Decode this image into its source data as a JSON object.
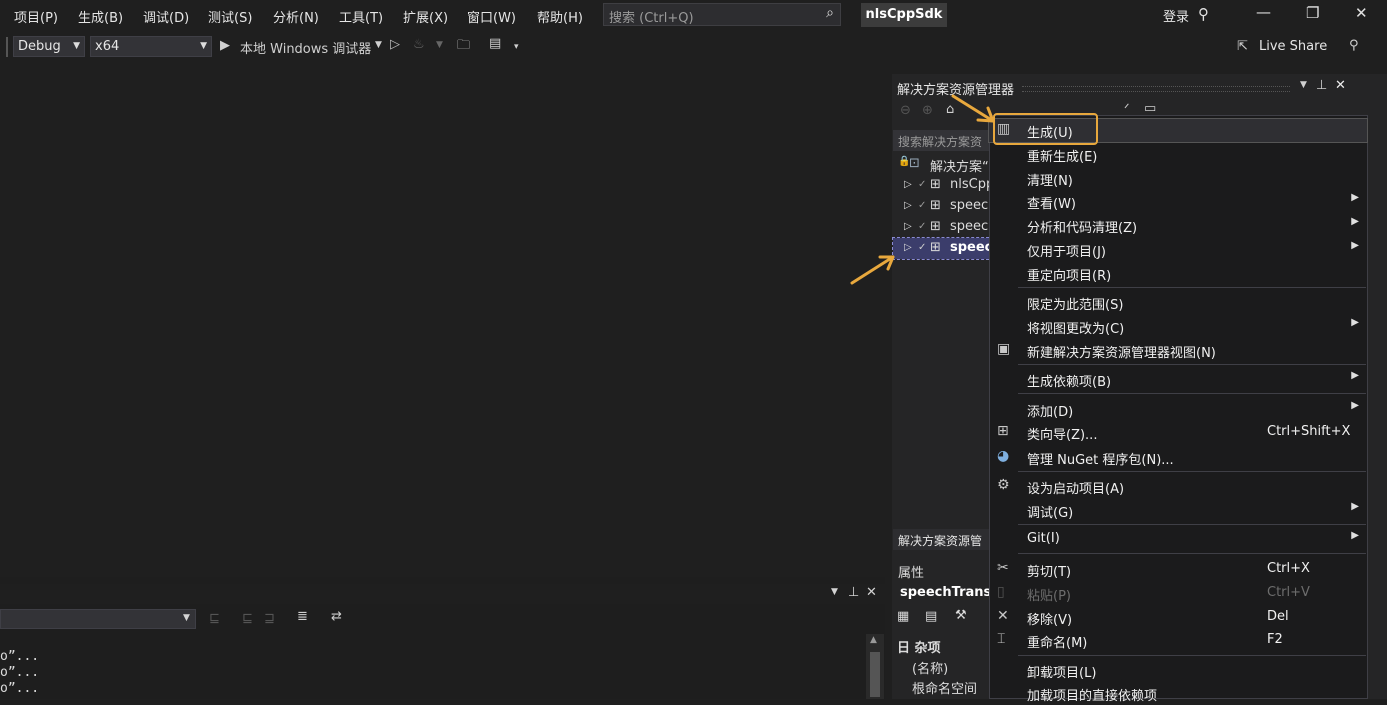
{
  "menubar": {
    "items": [
      "项目(P)",
      "生成(B)",
      "调试(D)",
      "测试(S)",
      "分析(N)",
      "工具(T)",
      "扩展(X)",
      "窗口(W)",
      "帮助(H)"
    ],
    "search_placeholder": "搜索 (Ctrl+Q)",
    "solution_name": "nlsCppSdk",
    "login": "登录"
  },
  "toolbar": {
    "config": "Debug",
    "platform": "x64",
    "run_label": "本地 Windows 调试器",
    "live_share": "Live Share"
  },
  "solution_explorer": {
    "title": "解决方案资源管理器",
    "search_placeholder": "搜索解决方案资",
    "tree": [
      "解决方案“",
      "nlsCpp",
      "speec",
      "speec",
      "speec"
    ],
    "bottom_tab": "解决方案资源管"
  },
  "context_menu": {
    "items": [
      {
        "label": "生成(U)",
        "icon": "build-icon"
      },
      {
        "label": "重新生成(E)"
      },
      {
        "label": "清理(N)"
      },
      {
        "label": "查看(W)",
        "submenu": true
      },
      {
        "label": "分析和代码清理(Z)",
        "submenu": true
      },
      {
        "label": "仅用于项目(J)",
        "submenu": true
      },
      {
        "label": "重定向项目(R)"
      },
      {
        "label": "限定为此范围(S)"
      },
      {
        "label": "将视图更改为(C)",
        "submenu": true
      },
      {
        "label": "新建解决方案资源管理器视图(N)",
        "icon": "new-view-icon"
      },
      {
        "label": "生成依赖项(B)",
        "submenu": true
      },
      {
        "label": "添加(D)",
        "submenu": true
      },
      {
        "label": "类向导(Z)...",
        "shortcut": "Ctrl+Shift+X",
        "icon": "class-wizard-icon"
      },
      {
        "label": "管理 NuGet 程序包(N)...",
        "icon": "nuget-icon"
      },
      {
        "label": "设为启动项目(A)",
        "icon": "gear-icon"
      },
      {
        "label": "调试(G)",
        "submenu": true
      },
      {
        "label": "Git(I)",
        "submenu": true
      },
      {
        "label": "剪切(T)",
        "shortcut": "Ctrl+X",
        "icon": "scissors-icon"
      },
      {
        "label": "粘贴(P)",
        "shortcut": "Ctrl+V",
        "icon": "paste-icon",
        "disabled": true
      },
      {
        "label": "移除(V)",
        "shortcut": "Del",
        "icon": "remove-icon"
      },
      {
        "label": "重命名(M)",
        "shortcut": "F2",
        "icon": "rename-icon"
      },
      {
        "label": "卸载项目(L)"
      },
      {
        "label": "加载项目的直接依赖项"
      }
    ]
  },
  "properties": {
    "header": "属性",
    "object": "speechTransc",
    "category": "日 杂项",
    "rows": [
      "(名称)",
      "根命名空间"
    ]
  },
  "output": {
    "lines": [
      "o”...",
      "o”...",
      "o”..."
    ]
  },
  "colors": {
    "highlight_box": "#e8a83d",
    "arrow": "#e8a83d",
    "selected_row": "#3b3d6b"
  }
}
